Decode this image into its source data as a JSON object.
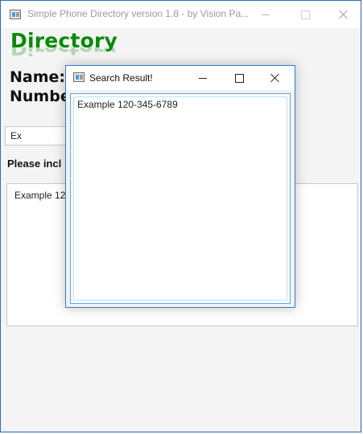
{
  "window": {
    "title": "Simple Phone Directory version 1.8 -  by Vision Pa...",
    "icon": "app-window-icon"
  },
  "main": {
    "heading": "Directory",
    "name_label": "Name:",
    "number_label": "Numbe",
    "search_value": "Ex",
    "hint": "Please incl",
    "results": [
      "Example 120"
    ]
  },
  "dialog": {
    "title": "Search Result!",
    "results": [
      "Example 120-345-6789"
    ]
  },
  "colors": {
    "heading": "#078a0a",
    "window_border": "#2b6fb6",
    "dialog_border": "#2b7fd0",
    "list_focus": "#5aa9e6"
  }
}
